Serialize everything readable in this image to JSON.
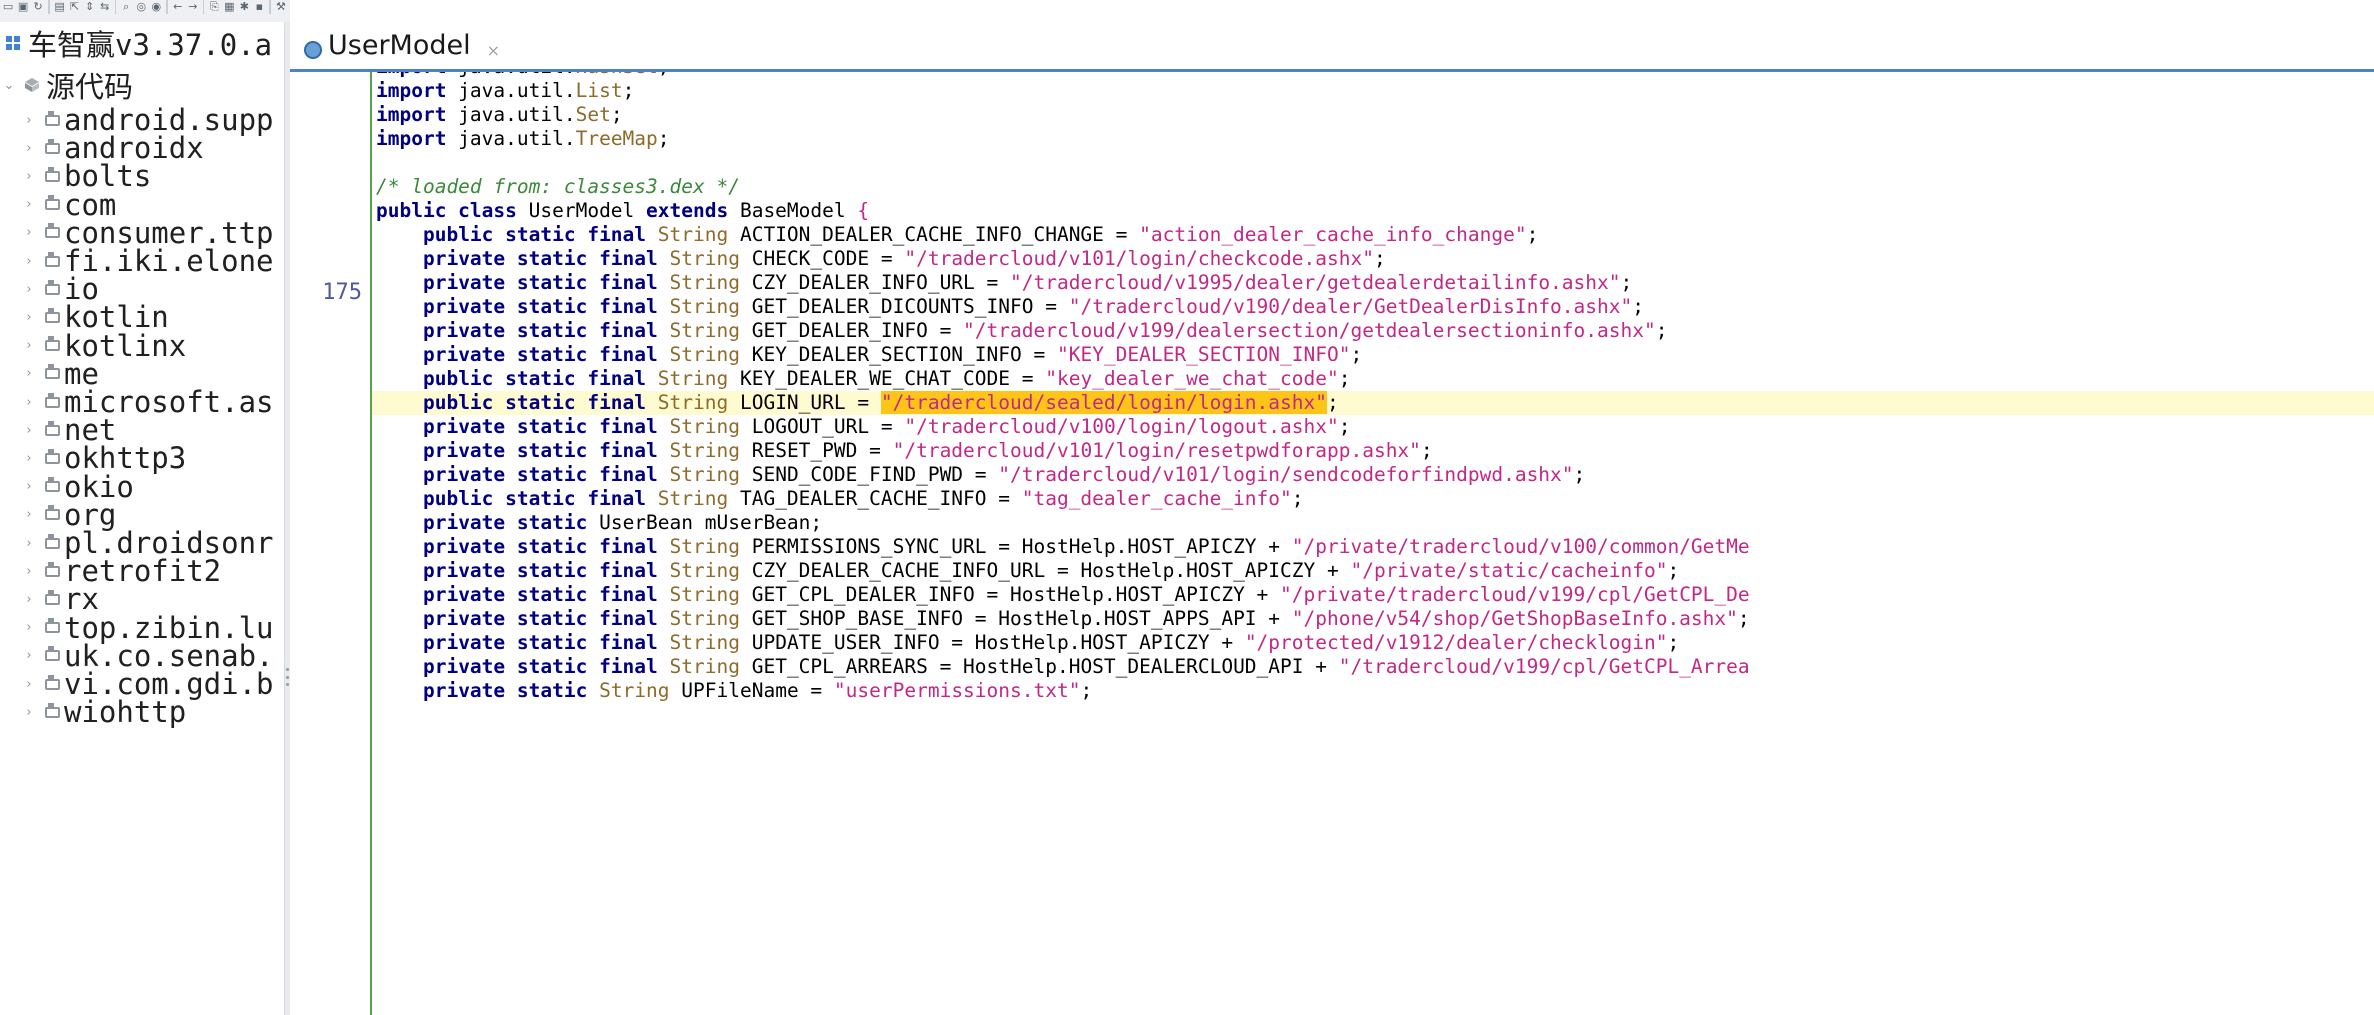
{
  "toolbar": {
    "icons": [
      "open-icon",
      "save-icon",
      "refresh-icon",
      "save-all-icon",
      "export-icon",
      "collapse-icon",
      "sync-icon",
      "search-icon",
      "find-class-icon",
      "find-usage-icon",
      "back-icon",
      "forward-icon",
      "decompile-icon",
      "log-icon",
      "bug-icon",
      "stop-icon",
      "settings-icon"
    ]
  },
  "tree": {
    "project_label": "车智赢v3.37.0.a",
    "source_label": "源代码",
    "packages": [
      "android.supp",
      "androidx",
      "bolts",
      "com",
      "consumer.ttp",
      "fi.iki.elone",
      "io",
      "kotlin",
      "kotlinx",
      "me",
      "microsoft.as",
      "net",
      "okhttp3",
      "okio",
      "org",
      "pl.droidsonr",
      "retrofit2",
      "rx",
      "top.zibin.lu",
      "uk.co.senab.",
      "vi.com.gdi.b",
      "wiohttp"
    ]
  },
  "editor": {
    "tab_title": "UserModel",
    "tab_close": "×",
    "line_number": "175",
    "lines": [
      [
        [
          "kw",
          "import"
        ],
        [
          "p",
          " java.util."
        ],
        [
          "type",
          "HashSet"
        ],
        [
          "p",
          ";"
        ]
      ],
      [
        [
          "kw",
          "import"
        ],
        [
          "p",
          " java.util."
        ],
        [
          "type",
          "List"
        ],
        [
          "p",
          ";"
        ]
      ],
      [
        [
          "kw",
          "import"
        ],
        [
          "p",
          " java.util."
        ],
        [
          "type",
          "Set"
        ],
        [
          "p",
          ";"
        ]
      ],
      [
        [
          "kw",
          "import"
        ],
        [
          "p",
          " java.util."
        ],
        [
          "type",
          "TreeMap"
        ],
        [
          "p",
          ";"
        ]
      ],
      [],
      [
        [
          "cmt",
          "/* loaded from: classes3.dex */"
        ]
      ],
      [
        [
          "kw",
          "public class"
        ],
        [
          "p",
          " UserModel "
        ],
        [
          "kw",
          "extends"
        ],
        [
          "p",
          " BaseModel "
        ],
        [
          "str",
          "{"
        ]
      ],
      [
        [
          "p",
          "    "
        ],
        [
          "kw",
          "public static final"
        ],
        [
          "p",
          " "
        ],
        [
          "type",
          "String"
        ],
        [
          "p",
          " ACTION_DEALER_CACHE_INFO_CHANGE = "
        ],
        [
          "str",
          "\"action_dealer_cache_info_change\""
        ],
        [
          "p",
          ";"
        ]
      ],
      [
        [
          "p",
          "    "
        ],
        [
          "kw",
          "private static final"
        ],
        [
          "p",
          " "
        ],
        [
          "type",
          "String"
        ],
        [
          "p",
          " CHECK_CODE = "
        ],
        [
          "str",
          "\"/tradercloud/v101/login/checkcode.ashx\""
        ],
        [
          "p",
          ";"
        ]
      ],
      [
        [
          "p",
          "    "
        ],
        [
          "kw",
          "private static final"
        ],
        [
          "p",
          " "
        ],
        [
          "type",
          "String"
        ],
        [
          "p",
          " CZY_DEALER_INFO_URL = "
        ],
        [
          "str",
          "\"/tradercloud/v1995/dealer/getdealerdetailinfo.ashx\""
        ],
        [
          "p",
          ";"
        ]
      ],
      [
        [
          "p",
          "    "
        ],
        [
          "kw",
          "private static final"
        ],
        [
          "p",
          " "
        ],
        [
          "type",
          "String"
        ],
        [
          "p",
          " GET_DEALER_DICOUNTS_INFO = "
        ],
        [
          "str",
          "\"/tradercloud/v190/dealer/GetDealerDisInfo.ashx\""
        ],
        [
          "p",
          ";"
        ]
      ],
      [
        [
          "p",
          "    "
        ],
        [
          "kw",
          "private static final"
        ],
        [
          "p",
          " "
        ],
        [
          "type",
          "String"
        ],
        [
          "p",
          " GET_DEALER_INFO = "
        ],
        [
          "str",
          "\"/tradercloud/v199/dealersection/getdealersectioninfo.ashx\""
        ],
        [
          "p",
          ";"
        ]
      ],
      [
        [
          "p",
          "    "
        ],
        [
          "kw",
          "private static final"
        ],
        [
          "p",
          " "
        ],
        [
          "type",
          "String"
        ],
        [
          "p",
          " KEY_DEALER_SECTION_INFO = "
        ],
        [
          "str",
          "\"KEY_DEALER_SECTION_INFO\""
        ],
        [
          "p",
          ";"
        ]
      ],
      [
        [
          "p",
          "    "
        ],
        [
          "kw",
          "public static final"
        ],
        [
          "p",
          " "
        ],
        [
          "type",
          "String"
        ],
        [
          "p",
          " KEY_DEALER_WE_CHAT_CODE = "
        ],
        [
          "str",
          "\"key_dealer_we_chat_code\""
        ],
        [
          "p",
          ";"
        ]
      ],
      [
        [
          "p",
          "    "
        ],
        [
          "kw",
          "public static final"
        ],
        [
          "p",
          " "
        ],
        [
          "type",
          "String"
        ],
        [
          "p",
          " LOGIN_URL = "
        ],
        [
          "sel",
          "\"/tradercloud/sealed/login/login.ashx\""
        ],
        [
          "p",
          ";"
        ]
      ],
      [
        [
          "p",
          "    "
        ],
        [
          "kw",
          "private static final"
        ],
        [
          "p",
          " "
        ],
        [
          "type",
          "String"
        ],
        [
          "p",
          " LOGOUT_URL = "
        ],
        [
          "str",
          "\"/tradercloud/v100/login/logout.ashx\""
        ],
        [
          "p",
          ";"
        ]
      ],
      [
        [
          "p",
          "    "
        ],
        [
          "kw",
          "private static final"
        ],
        [
          "p",
          " "
        ],
        [
          "type",
          "String"
        ],
        [
          "p",
          " RESET_PWD = "
        ],
        [
          "str",
          "\"/tradercloud/v101/login/resetpwdforapp.ashx\""
        ],
        [
          "p",
          ";"
        ]
      ],
      [
        [
          "p",
          "    "
        ],
        [
          "kw",
          "private static final"
        ],
        [
          "p",
          " "
        ],
        [
          "type",
          "String"
        ],
        [
          "p",
          " SEND_CODE_FIND_PWD = "
        ],
        [
          "str",
          "\"/tradercloud/v101/login/sendcodeforfindpwd.ashx\""
        ],
        [
          "p",
          ";"
        ]
      ],
      [
        [
          "p",
          "    "
        ],
        [
          "kw",
          "public static final"
        ],
        [
          "p",
          " "
        ],
        [
          "type",
          "String"
        ],
        [
          "p",
          " TAG_DEALER_CACHE_INFO = "
        ],
        [
          "str",
          "\"tag_dealer_cache_info\""
        ],
        [
          "p",
          ";"
        ]
      ],
      [
        [
          "p",
          "    "
        ],
        [
          "kw",
          "private static"
        ],
        [
          "p",
          " UserBean mUserBean;"
        ]
      ],
      [
        [
          "p",
          "    "
        ],
        [
          "kw",
          "private static final"
        ],
        [
          "p",
          " "
        ],
        [
          "type",
          "String"
        ],
        [
          "p",
          " PERMISSIONS_SYNC_URL = HostHelp.HOST_APICZY + "
        ],
        [
          "str",
          "\"/private/tradercloud/v100/common/GetMe"
        ]
      ],
      [
        [
          "p",
          "    "
        ],
        [
          "kw",
          "private static final"
        ],
        [
          "p",
          " "
        ],
        [
          "type",
          "String"
        ],
        [
          "p",
          " CZY_DEALER_CACHE_INFO_URL = HostHelp.HOST_APICZY + "
        ],
        [
          "str",
          "\"/private/static/cacheinfo\""
        ],
        [
          "p",
          ";"
        ]
      ],
      [
        [
          "p",
          "    "
        ],
        [
          "kw",
          "private static final"
        ],
        [
          "p",
          " "
        ],
        [
          "type",
          "String"
        ],
        [
          "p",
          " GET_CPL_DEALER_INFO = HostHelp.HOST_APICZY + "
        ],
        [
          "str",
          "\"/private/tradercloud/v199/cpl/GetCPL_De"
        ]
      ],
      [
        [
          "p",
          "    "
        ],
        [
          "kw",
          "private static final"
        ],
        [
          "p",
          " "
        ],
        [
          "type",
          "String"
        ],
        [
          "p",
          " GET_SHOP_BASE_INFO = HostHelp.HOST_APPS_API + "
        ],
        [
          "str",
          "\"/phone/v54/shop/GetShopBaseInfo.ashx\""
        ],
        [
          "p",
          ";"
        ]
      ],
      [
        [
          "p",
          "    "
        ],
        [
          "kw",
          "private static final"
        ],
        [
          "p",
          " "
        ],
        [
          "type",
          "String"
        ],
        [
          "p",
          " UPDATE_USER_INFO = HostHelp.HOST_APICZY + "
        ],
        [
          "str",
          "\"/protected/v1912/dealer/checklogin\""
        ],
        [
          "p",
          ";"
        ]
      ],
      [
        [
          "p",
          "    "
        ],
        [
          "kw",
          "private static final"
        ],
        [
          "p",
          " "
        ],
        [
          "type",
          "String"
        ],
        [
          "p",
          " GET_CPL_ARREARS = HostHelp.HOST_DEALERCLOUD_API + "
        ],
        [
          "str",
          "\"/tradercloud/v199/cpl/GetCPL_Arrea"
        ]
      ],
      [
        [
          "p",
          "    "
        ],
        [
          "kw",
          "private static"
        ],
        [
          "p",
          " "
        ],
        [
          "type",
          "String"
        ],
        [
          "p",
          " UPFileName = "
        ],
        [
          "str",
          "\"userPermissions.txt\""
        ],
        [
          "p",
          ";"
        ]
      ]
    ]
  },
  "colors": {
    "keyword": "#000080",
    "type": "#8d6b2a",
    "string": "#c12887",
    "comment": "#3a8a3a",
    "selection": "#ffc418",
    "current_line": "#fffbd0",
    "tab_underline": "#4d82c4"
  }
}
